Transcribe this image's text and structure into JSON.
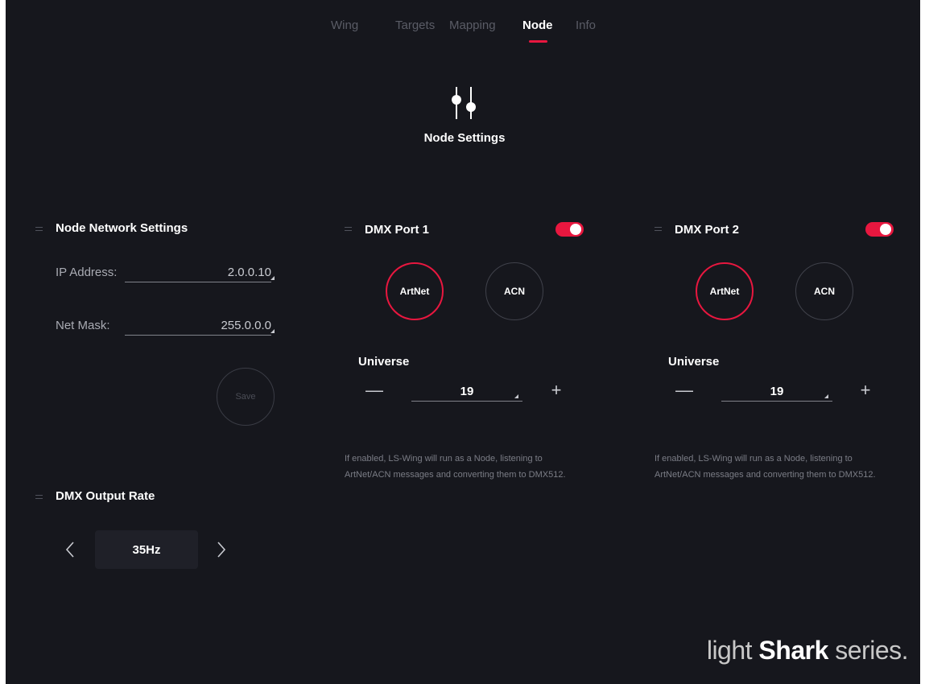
{
  "tabs": [
    {
      "label": "Wing",
      "active": false
    },
    {
      "label": "Targets",
      "active": false
    },
    {
      "label": "Mapping",
      "active": false
    },
    {
      "label": "Node",
      "active": true
    },
    {
      "label": "Info",
      "active": false
    }
  ],
  "header": {
    "title": "Node Settings",
    "icon": "sliders-icon"
  },
  "network": {
    "title": "Node Network Settings",
    "ip_label": "IP Address:",
    "ip_value": "2.0.0.10",
    "mask_label": "Net Mask:",
    "mask_value": "255.0.0.0",
    "save_label": "Save"
  },
  "output_rate": {
    "title": "DMX Output Rate",
    "value": "35Hz"
  },
  "ports": [
    {
      "title": "DMX Port 1",
      "enabled": true,
      "protocols": [
        "ArtNet",
        "ACN"
      ],
      "selected_protocol": "ArtNet",
      "universe_label": "Universe",
      "universe_value": "19",
      "help": "If enabled, LS-Wing will run as a Node, listening to ArtNet/ACN messages and converting them to DMX512."
    },
    {
      "title": "DMX Port 2",
      "enabled": true,
      "protocols": [
        "ArtNet",
        "ACN"
      ],
      "selected_protocol": "ArtNet",
      "universe_label": "Universe",
      "universe_value": "19",
      "help": "If enabled, LS-Wing will run as a Node, listening to ArtNet/ACN messages and converting them to DMX512."
    }
  ],
  "brand": {
    "light": "light",
    "shark": "Shark",
    "series": "series."
  },
  "colors": {
    "accent": "#e8173f",
    "background": "#16171d"
  }
}
